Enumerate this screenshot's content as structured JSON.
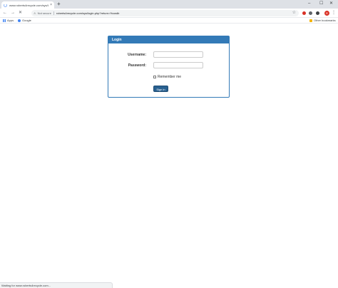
{
  "tab": {
    "title": "www.roberts4recycle.com/sys/lo",
    "close": "×"
  },
  "new_tab": "+",
  "window_controls": {
    "minimize": "–",
    "maximize": "☐",
    "close": "✕"
  },
  "toolbar": {
    "back": "←",
    "forward": "→",
    "reload": "✕",
    "security": "Not secure",
    "url": "roberts4recycle.com/sys/login.php?return=%cwdb",
    "bookmark_star": "☆",
    "avatar_letter": "R",
    "menu": "⋮"
  },
  "bookmarks": {
    "apps": "Apps",
    "google": "Google",
    "other": "Other bookmarks"
  },
  "login": {
    "heading": "Login",
    "username_label": "Username:",
    "password_label": "Password:",
    "username_value": "",
    "password_value": "",
    "remember_label": "Remember me",
    "remember_checked": false,
    "submit": "Sign in"
  },
  "status_bar": "Waiting for www.roberts4recycle.com...",
  "colors": {
    "primary": "#337ab7",
    "button": "#286090",
    "chrome_tabstrip": "#dee1e6"
  }
}
